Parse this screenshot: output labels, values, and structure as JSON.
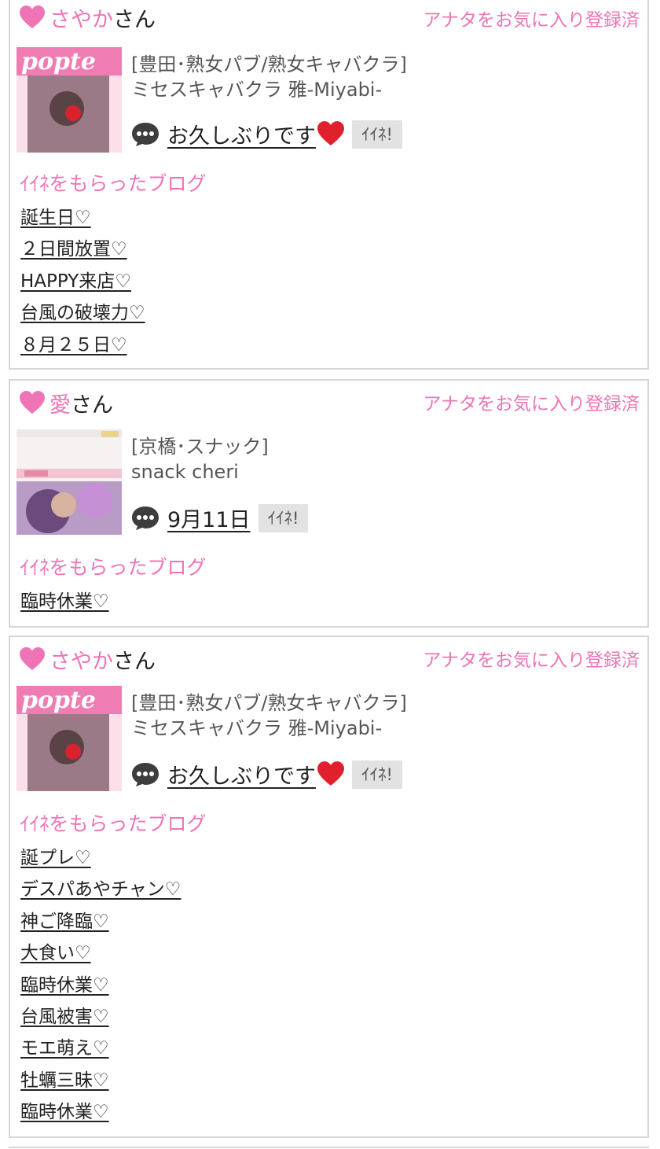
{
  "cards": [
    {
      "name": "さやか",
      "suffix": "さん",
      "fav_status": "アナタをお気に入り登録済",
      "thumb_label": "popte",
      "shop_category": "[豊田･熟女パブ/熟女キャバクラ]",
      "shop_name": "ミセスキャバクラ 雅-Miyabi-",
      "message": "お久しぶりです",
      "like_label": "ｲｲﾈ!",
      "blog_heading": "ｲｲﾈをもらったブログ",
      "blogs": [
        "誕生日♡",
        "２日間放置♡",
        "HAPPY来店♡",
        "台風の破壊力♡",
        "８月２５日♡"
      ]
    },
    {
      "name": "愛",
      "suffix": "さん",
      "fav_status": "アナタをお気に入り登録済",
      "thumb_label": "",
      "shop_category": "[京橋･スナック]",
      "shop_name": "snack cheri",
      "message": "9月11日",
      "like_label": "ｲｲﾈ!",
      "blog_heading": "ｲｲﾈをもらったブログ",
      "blogs": [
        "臨時休業♡"
      ]
    },
    {
      "name": "さやか",
      "suffix": "さん",
      "fav_status": "アナタをお気に入り登録済",
      "thumb_label": "popte",
      "shop_category": "[豊田･熟女パブ/熟女キャバクラ]",
      "shop_name": "ミセスキャバクラ 雅-Miyabi-",
      "message": "お久しぶりです",
      "like_label": "ｲｲﾈ!",
      "blog_heading": "ｲｲﾈをもらったブログ",
      "blogs": [
        "誕プレ♡",
        "デスパあやチャン♡",
        "神ご降臨♡",
        "大食い♡",
        "臨時休業♡",
        "台風被害♡",
        "モエ萌え♡",
        "牡蠣三昧♡",
        "臨時休業♡"
      ]
    }
  ],
  "colors": {
    "accent": "#ee74b6",
    "like_bg": "#e2e2e2",
    "border": "#d6d6d6"
  }
}
